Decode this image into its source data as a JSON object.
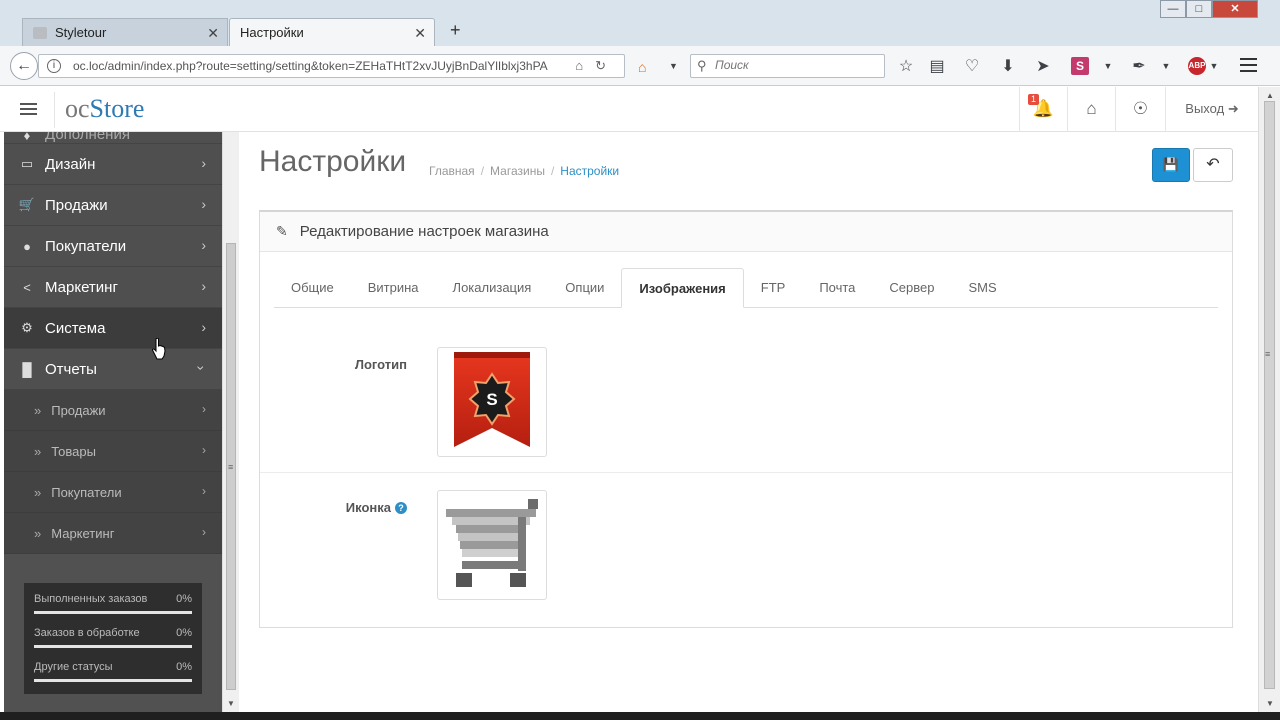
{
  "browser": {
    "tabs": [
      {
        "title": "Styletour",
        "close": "✕"
      },
      {
        "title": "Настройки",
        "close": "✕"
      }
    ],
    "new_tab": "+",
    "window_buttons": {
      "minimize": "—",
      "maximize": "□",
      "close": "✕"
    },
    "url": "oc.loc/admin/index.php?route=setting/setting&token=ZEHaTHtT2xvJUyjBnDalYlIblxj3hPA",
    "search_placeholder": "Поиск",
    "icons": [
      "star-icon",
      "reading-list-icon",
      "pocket-icon",
      "download-icon",
      "send-icon",
      "s-extension-icon",
      "pen-extension-icon",
      "adblock-icon",
      "menu-icon"
    ],
    "s_badge": "S",
    "abp_badge": "ABP"
  },
  "header": {
    "logo_oc": "oc",
    "logo_store": "Store",
    "notification_count": "1",
    "logout_label": "Выход"
  },
  "sidebar": {
    "items": [
      {
        "label": "Дополнения",
        "icon": "puzzle-icon"
      },
      {
        "label": "Дизайн",
        "icon": "monitor-icon"
      },
      {
        "label": "Продажи",
        "icon": "cart-icon"
      },
      {
        "label": "Покупатели",
        "icon": "user-icon"
      },
      {
        "label": "Маркетинг",
        "icon": "share-icon"
      },
      {
        "label": "Система",
        "icon": "gear-icon"
      },
      {
        "label": "Отчеты",
        "icon": "bar-chart-icon"
      }
    ],
    "subitems": [
      {
        "label": "Продажи"
      },
      {
        "label": "Товары"
      },
      {
        "label": "Покупатели"
      },
      {
        "label": "Маркетинг"
      }
    ],
    "stats": [
      {
        "label": "Выполненных заказов",
        "value": "0%",
        "progress": 0
      },
      {
        "label": "Заказов в обработке",
        "value": "0%",
        "progress": 0
      },
      {
        "label": "Другие статусы",
        "value": "0%",
        "progress": 0
      }
    ]
  },
  "page": {
    "title": "Настройки",
    "breadcrumbs": [
      "Главная",
      "Магазины",
      "Настройки"
    ],
    "panel_title": "Редактирование настроек магазина",
    "tabs": [
      "Общие",
      "Витрина",
      "Локализация",
      "Опции",
      "Изображения",
      "FTP",
      "Почта",
      "Сервер",
      "SMS"
    ],
    "active_tab": "Изображения",
    "fields": {
      "logo_label": "Логотип",
      "logo_letter": "S",
      "icon_label": "Иконка",
      "help_mark": "?"
    }
  },
  "colors": {
    "accent": "#1e91d5",
    "sidebar_bg": "#515151",
    "logo_red": "#d42a1c"
  }
}
